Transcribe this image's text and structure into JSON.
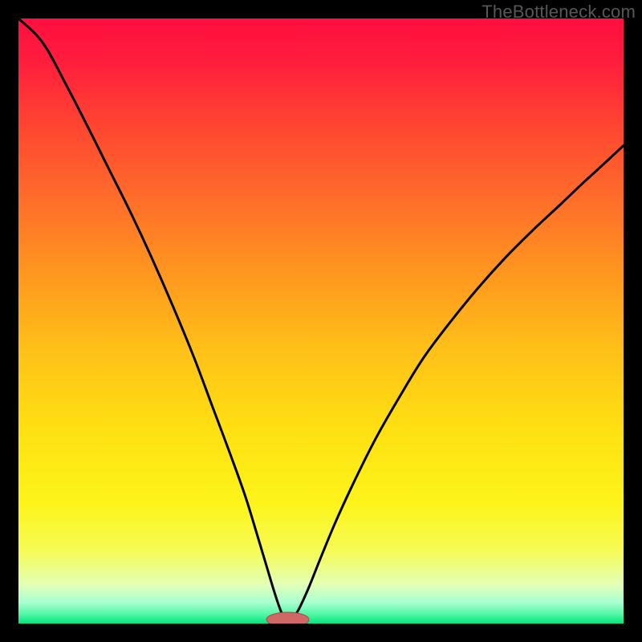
{
  "watermark": "TheBottleneck.com",
  "chart_data": {
    "type": "line",
    "title": "",
    "xlabel": "",
    "ylabel": "",
    "xlim": [
      0,
      1
    ],
    "ylim": [
      0,
      1
    ],
    "notch_x": 0.445,
    "marker": {
      "cx": 0.445,
      "cy": 0.0,
      "rx": 0.035,
      "ry": 0.008
    },
    "series": [
      {
        "name": "left-curve",
        "points": [
          {
            "x": 0.0,
            "y": 1.0
          },
          {
            "x": 0.04,
            "y": 0.96
          },
          {
            "x": 0.08,
            "y": 0.888
          },
          {
            "x": 0.115,
            "y": 0.82
          },
          {
            "x": 0.15,
            "y": 0.75
          },
          {
            "x": 0.185,
            "y": 0.68
          },
          {
            "x": 0.22,
            "y": 0.605
          },
          {
            "x": 0.255,
            "y": 0.525
          },
          {
            "x": 0.29,
            "y": 0.44
          },
          {
            "x": 0.32,
            "y": 0.36
          },
          {
            "x": 0.35,
            "y": 0.28
          },
          {
            "x": 0.375,
            "y": 0.21
          },
          {
            "x": 0.395,
            "y": 0.145
          },
          {
            "x": 0.41,
            "y": 0.095
          },
          {
            "x": 0.422,
            "y": 0.055
          },
          {
            "x": 0.432,
            "y": 0.025
          },
          {
            "x": 0.44,
            "y": 0.006
          },
          {
            "x": 0.445,
            "y": 0.0
          }
        ]
      },
      {
        "name": "right-curve",
        "points": [
          {
            "x": 0.445,
            "y": 0.0
          },
          {
            "x": 0.452,
            "y": 0.006
          },
          {
            "x": 0.464,
            "y": 0.025
          },
          {
            "x": 0.48,
            "y": 0.06
          },
          {
            "x": 0.5,
            "y": 0.11
          },
          {
            "x": 0.525,
            "y": 0.17
          },
          {
            "x": 0.555,
            "y": 0.235
          },
          {
            "x": 0.59,
            "y": 0.305
          },
          {
            "x": 0.63,
            "y": 0.375
          },
          {
            "x": 0.67,
            "y": 0.44
          },
          {
            "x": 0.715,
            "y": 0.5
          },
          {
            "x": 0.76,
            "y": 0.555
          },
          {
            "x": 0.805,
            "y": 0.605
          },
          {
            "x": 0.85,
            "y": 0.65
          },
          {
            "x": 0.895,
            "y": 0.692
          },
          {
            "x": 0.935,
            "y": 0.73
          },
          {
            "x": 0.97,
            "y": 0.762
          },
          {
            "x": 1.0,
            "y": 0.79
          }
        ]
      }
    ],
    "gradient_stops": [
      {
        "offset": 0.0,
        "color": "#ff0f3f"
      },
      {
        "offset": 0.07,
        "color": "#ff1d3d"
      },
      {
        "offset": 0.18,
        "color": "#ff4631"
      },
      {
        "offset": 0.3,
        "color": "#ff6e2a"
      },
      {
        "offset": 0.42,
        "color": "#ff961f"
      },
      {
        "offset": 0.55,
        "color": "#ffc118"
      },
      {
        "offset": 0.68,
        "color": "#ffe012"
      },
      {
        "offset": 0.8,
        "color": "#fdf41a"
      },
      {
        "offset": 0.88,
        "color": "#f6fb55"
      },
      {
        "offset": 0.935,
        "color": "#e3ffb6"
      },
      {
        "offset": 0.965,
        "color": "#a9ffd0"
      },
      {
        "offset": 0.985,
        "color": "#50f7a5"
      },
      {
        "offset": 1.0,
        "color": "#00e57f"
      }
    ],
    "marker_fill": "#d06868",
    "marker_stroke": "#a84a4a",
    "curve_stroke": "#000000",
    "curve_width": 3
  }
}
